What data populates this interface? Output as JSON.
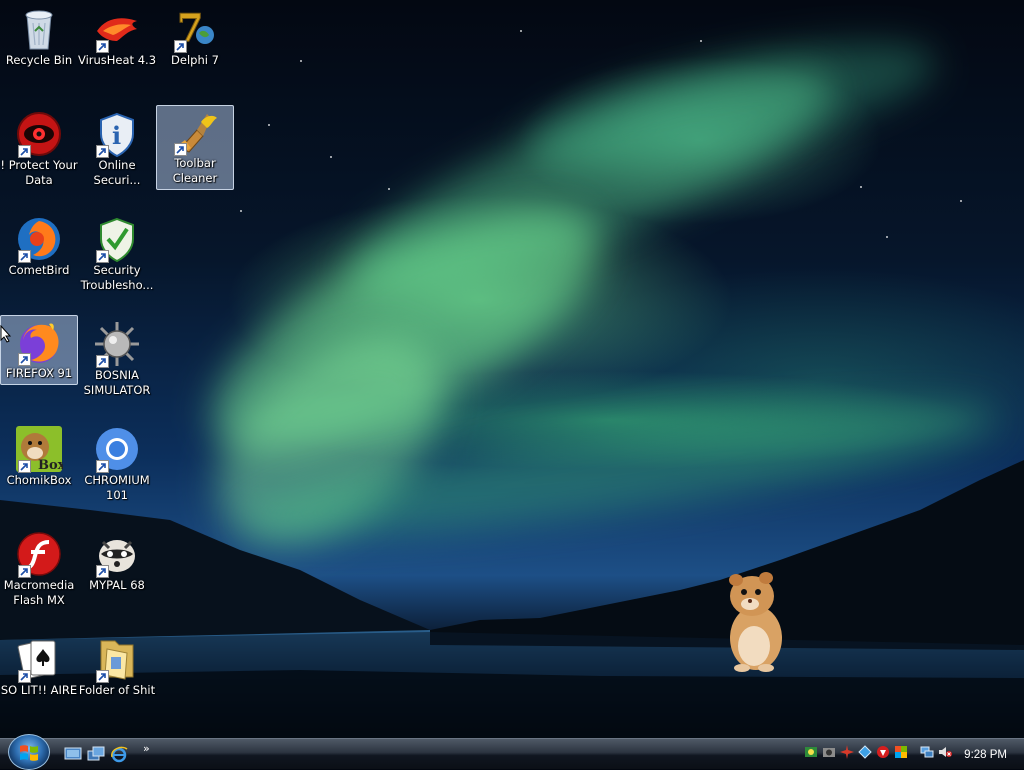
{
  "desktop_icons": [
    {
      "label": "Recycle Bin",
      "icon": "recycle-bin-icon",
      "shortcut": false
    },
    {
      "label": "VirusHeat 4.3",
      "icon": "virusheat-icon",
      "shortcut": true
    },
    {
      "label": "Delphi 7",
      "icon": "delphi-icon",
      "shortcut": true
    },
    {
      "label": "! Protect Your Data",
      "icon": "protect-data-icon",
      "shortcut": true
    },
    {
      "label": "Online Securi...",
      "icon": "online-security-icon",
      "shortcut": true
    },
    {
      "label": "Toolbar Cleaner",
      "icon": "toolbar-cleaner-icon",
      "shortcut": true,
      "selected": true
    },
    {
      "label": "CometBird",
      "icon": "cometbird-icon",
      "shortcut": true
    },
    {
      "label": "Security Troublesho...",
      "icon": "security-troubleshooter-icon",
      "shortcut": true
    },
    {
      "label": "FIREFOX 91",
      "icon": "firefox-icon",
      "shortcut": true,
      "selected": true
    },
    {
      "label": "BOSNIA SIMULATOR",
      "icon": "bosnia-simulator-icon",
      "shortcut": true
    },
    {
      "label": "ChomikBox",
      "icon": "chomikbox-icon",
      "shortcut": true
    },
    {
      "label": "CHROMIUM 101",
      "icon": "chromium-icon",
      "shortcut": true
    },
    {
      "label": "Macromedia Flash MX",
      "icon": "flash-icon",
      "shortcut": true
    },
    {
      "label": "MYPAL 68",
      "icon": "mypal-icon",
      "shortcut": true
    },
    {
      "label": "SO LIT!! AIRE",
      "icon": "solitaire-icon",
      "shortcut": true
    },
    {
      "label": "Folder of Shit",
      "icon": "folder-icon",
      "shortcut": true
    }
  ],
  "chomikbox_badge": "Box",
  "taskbar": {
    "start_button": "start-orb-icon",
    "quick_launch": [
      "show-desktop-icon",
      "switch-windows-icon",
      "internet-explorer-icon"
    ],
    "quick_launch_more": "»",
    "tray_icons": [
      "tray-app-icon",
      "tray-camera-icon",
      "tray-spark-icon",
      "tray-network-diamond-icon",
      "tray-red-app-icon",
      "tray-shield-icon",
      "tray-network-icon",
      "tray-volume-muted-icon"
    ],
    "clock": "9:28 PM"
  },
  "colors": {
    "selection": "#aabedc",
    "taskbar": "#1a212b",
    "aurora": "#78eb96"
  }
}
